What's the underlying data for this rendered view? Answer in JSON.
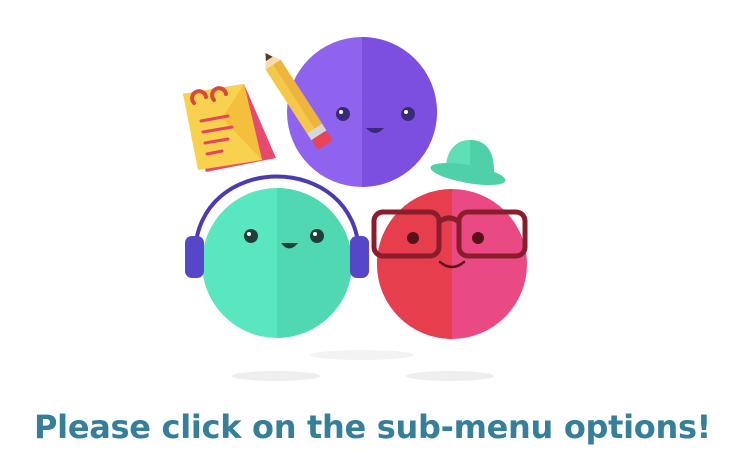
{
  "message": {
    "text": "Please click on the sub-menu options!",
    "color": "#367f9a"
  },
  "illustration": {
    "characters": [
      "purple-face",
      "green-face-with-headphones",
      "red-face-with-glasses"
    ],
    "props": [
      "notepad-icon",
      "pencil-icon",
      "hat-icon",
      "headphones-icon",
      "glasses-icon"
    ],
    "colors": {
      "purple": "#8c5fe9",
      "green": "#59e7bf",
      "red": "#e8445b",
      "headphones": "#4a3bb3",
      "glasses": "#8a1c2c",
      "hat": "#5de0b6",
      "notepad": "#f8d24e",
      "pencil": "#f6c84a"
    }
  }
}
